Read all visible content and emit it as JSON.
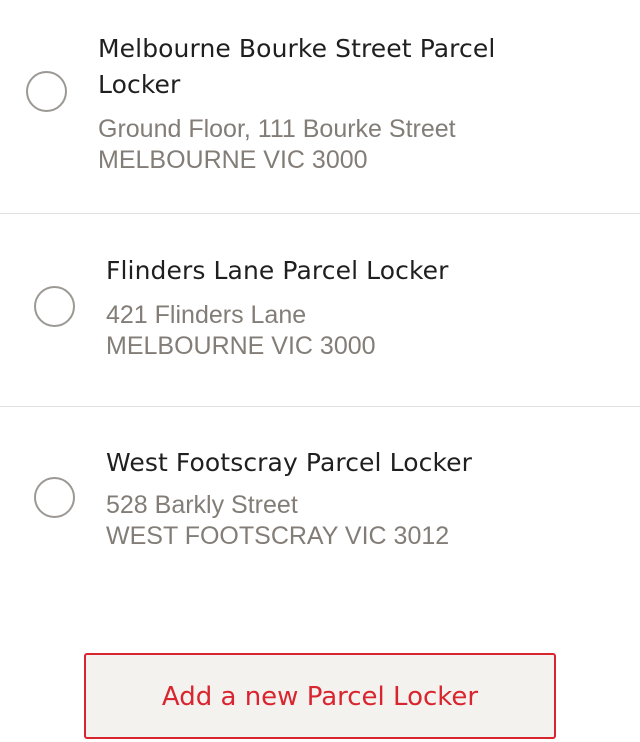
{
  "lockers": [
    {
      "name_line1": "Melbourne Bourke Street Parcel",
      "name_line2": "Locker",
      "address_line1": "Ground Floor, 111 Bourke Street",
      "address_line2": "MELBOURNE VIC 3000",
      "selected": false
    },
    {
      "name_line1": "Flinders Lane Parcel Locker",
      "address_line1": "421 Flinders Lane",
      "address_line2": "MELBOURNE VIC 3000",
      "selected": false
    },
    {
      "name_line1": "West Footscray Parcel Locker",
      "address_line1": "528 Barkly Street",
      "address_line2": "WEST FOOTSCRAY VIC 3012",
      "selected": false
    }
  ],
  "add_button": {
    "label": "Add a new Parcel Locker"
  },
  "colors": {
    "accent": "#d9252f",
    "address_text": "#837d78",
    "radio_border": "#9c9994",
    "divider": "#e3e1dd",
    "button_bg": "#f4f2ef"
  }
}
